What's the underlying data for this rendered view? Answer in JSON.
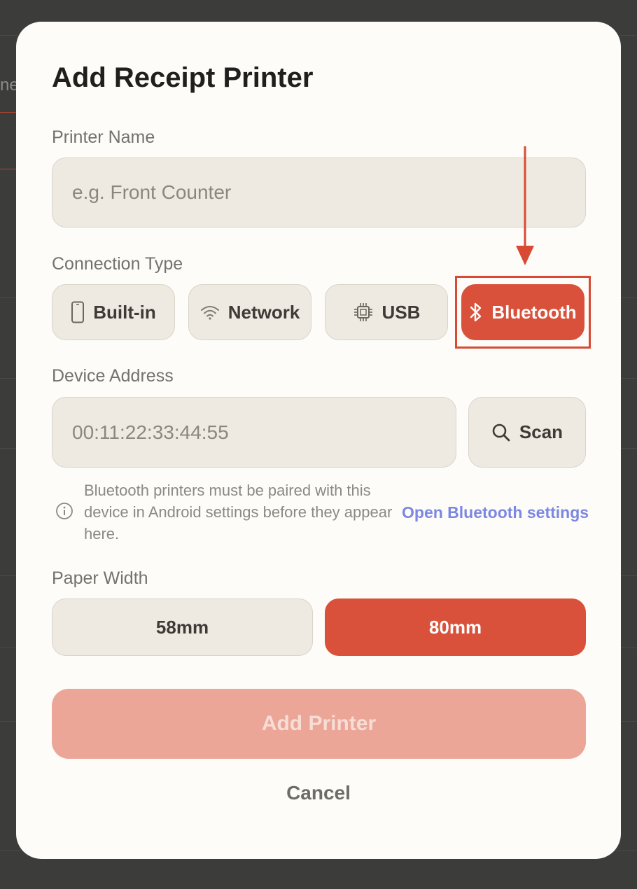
{
  "backdrop": {
    "peek_text": "ne"
  },
  "dialog": {
    "title": "Add Receipt Printer",
    "printer_name": {
      "label": "Printer Name",
      "value": "",
      "placeholder": "e.g. Front Counter"
    },
    "connection_type": {
      "label": "Connection Type",
      "selected": "Bluetooth",
      "options": [
        {
          "label": "Built-in",
          "icon": "phone-icon"
        },
        {
          "label": "Network",
          "icon": "wifi-icon"
        },
        {
          "label": "USB",
          "icon": "chip-icon"
        },
        {
          "label": "Bluetooth",
          "icon": "bluetooth-icon"
        }
      ]
    },
    "device_address": {
      "label": "Device Address",
      "value": "",
      "placeholder": "00:11:22:33:44:55",
      "scan_label": "Scan",
      "scan_icon": "search-icon"
    },
    "info": {
      "icon": "info-icon",
      "text": "Bluetooth printers must be paired with this device in Android settings before they appear here.",
      "link_label": "Open Bluetooth settings"
    },
    "paper_width": {
      "label": "Paper Width",
      "selected": "80mm",
      "options": [
        "58mm",
        "80mm"
      ]
    },
    "add_button_label": "Add Printer",
    "cancel_label": "Cancel"
  },
  "colors": {
    "accent": "#d9513a",
    "add_button_disabled": "#eba697",
    "link": "#7b87e3",
    "annotation": "#d84a33"
  }
}
